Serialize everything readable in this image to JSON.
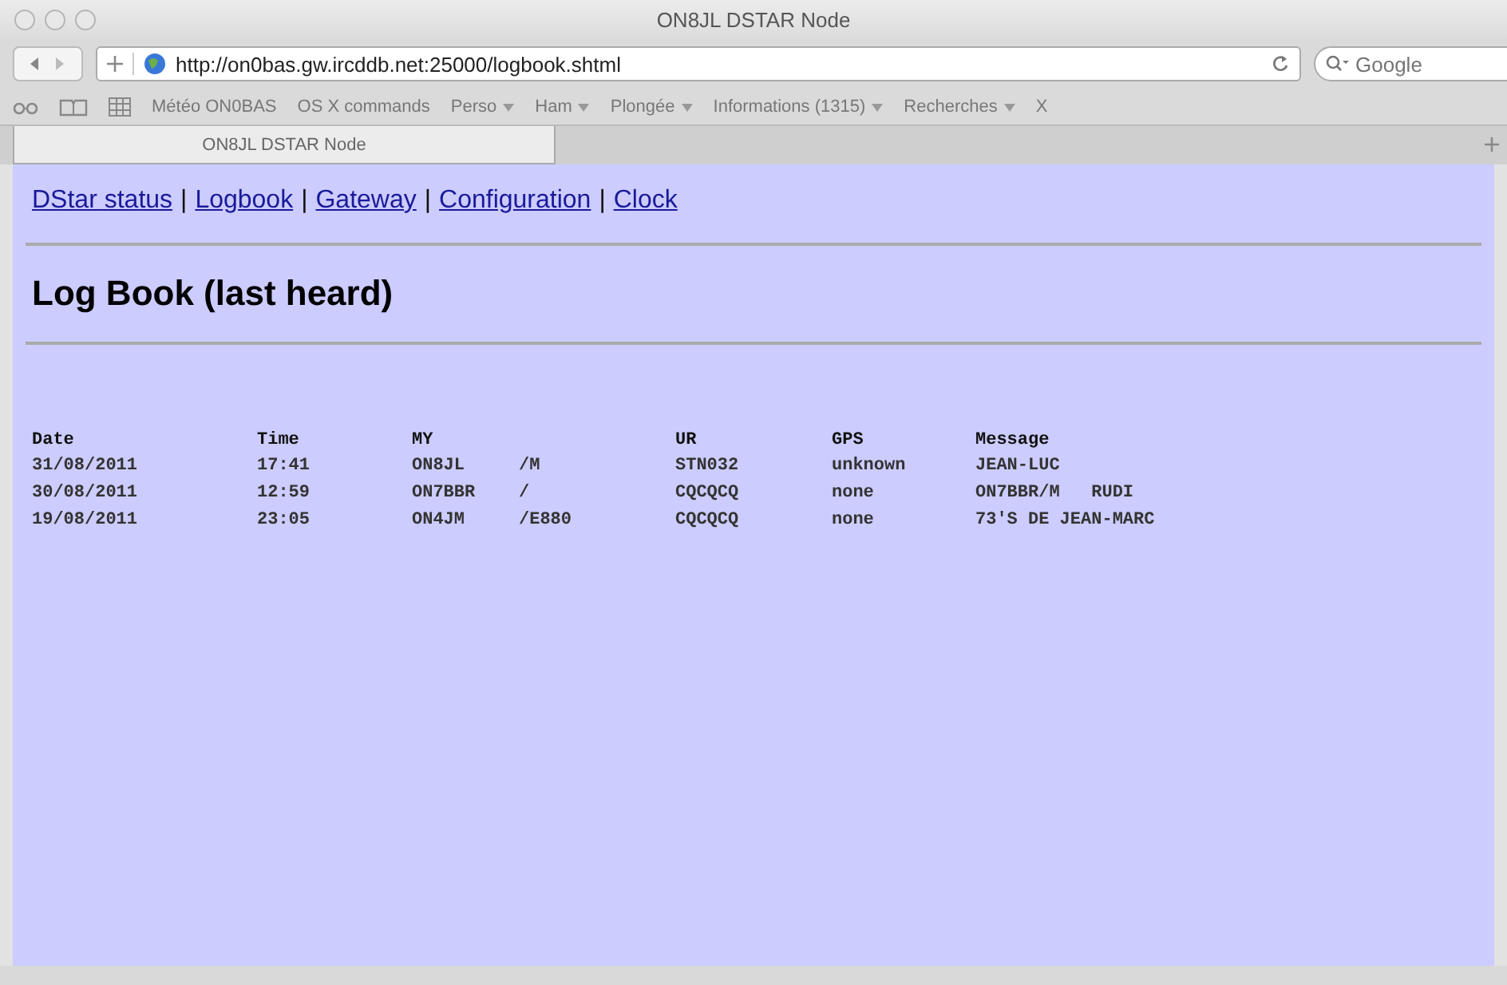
{
  "window": {
    "title": "ON8JL DSTAR Node"
  },
  "toolbar": {
    "url": "http://on0bas.gw.ircddb.net:25000/logbook.shtml",
    "search_placeholder": "Google"
  },
  "bookmarks": [
    {
      "label": "Météo ON0BAS",
      "menu": false
    },
    {
      "label": "OS X commands",
      "menu": false
    },
    {
      "label": "Perso",
      "menu": true
    },
    {
      "label": "Ham",
      "menu": true
    },
    {
      "label": "Plongée",
      "menu": true
    },
    {
      "label": "Informations (1315)",
      "menu": true
    },
    {
      "label": "Recherches",
      "menu": true
    },
    {
      "label": "X",
      "menu": false
    }
  ],
  "tab": {
    "label": "ON8JL DSTAR Node"
  },
  "nav_links": [
    {
      "label": "DStar status",
      "separator": "|"
    },
    {
      "label": "Logbook",
      "separator": "|"
    },
    {
      "label": "Gateway",
      "separator": "|"
    },
    {
      "label": "Configuration",
      "separator": "|"
    },
    {
      "label": "Clock"
    }
  ],
  "heading": "Log Book (last heard)",
  "table": {
    "columns": [
      "Date",
      "Time",
      "MY",
      null,
      "UR",
      "GPS",
      "Message"
    ],
    "rows": [
      [
        "31/08/2011",
        "17:41",
        "ON8JL",
        "/M",
        "STN032",
        "unknown",
        "JEAN-LUC"
      ],
      [
        "30/08/2011",
        "12:59",
        "ON7BBR",
        "/",
        "CQCQCQ",
        "none",
        "ON7BBR/M   RUDI"
      ],
      [
        "19/08/2011",
        "23:05",
        "ON4JM",
        "/E880",
        "CQCQCQ",
        "none",
        "73'S DE JEAN-MARC"
      ]
    ]
  }
}
